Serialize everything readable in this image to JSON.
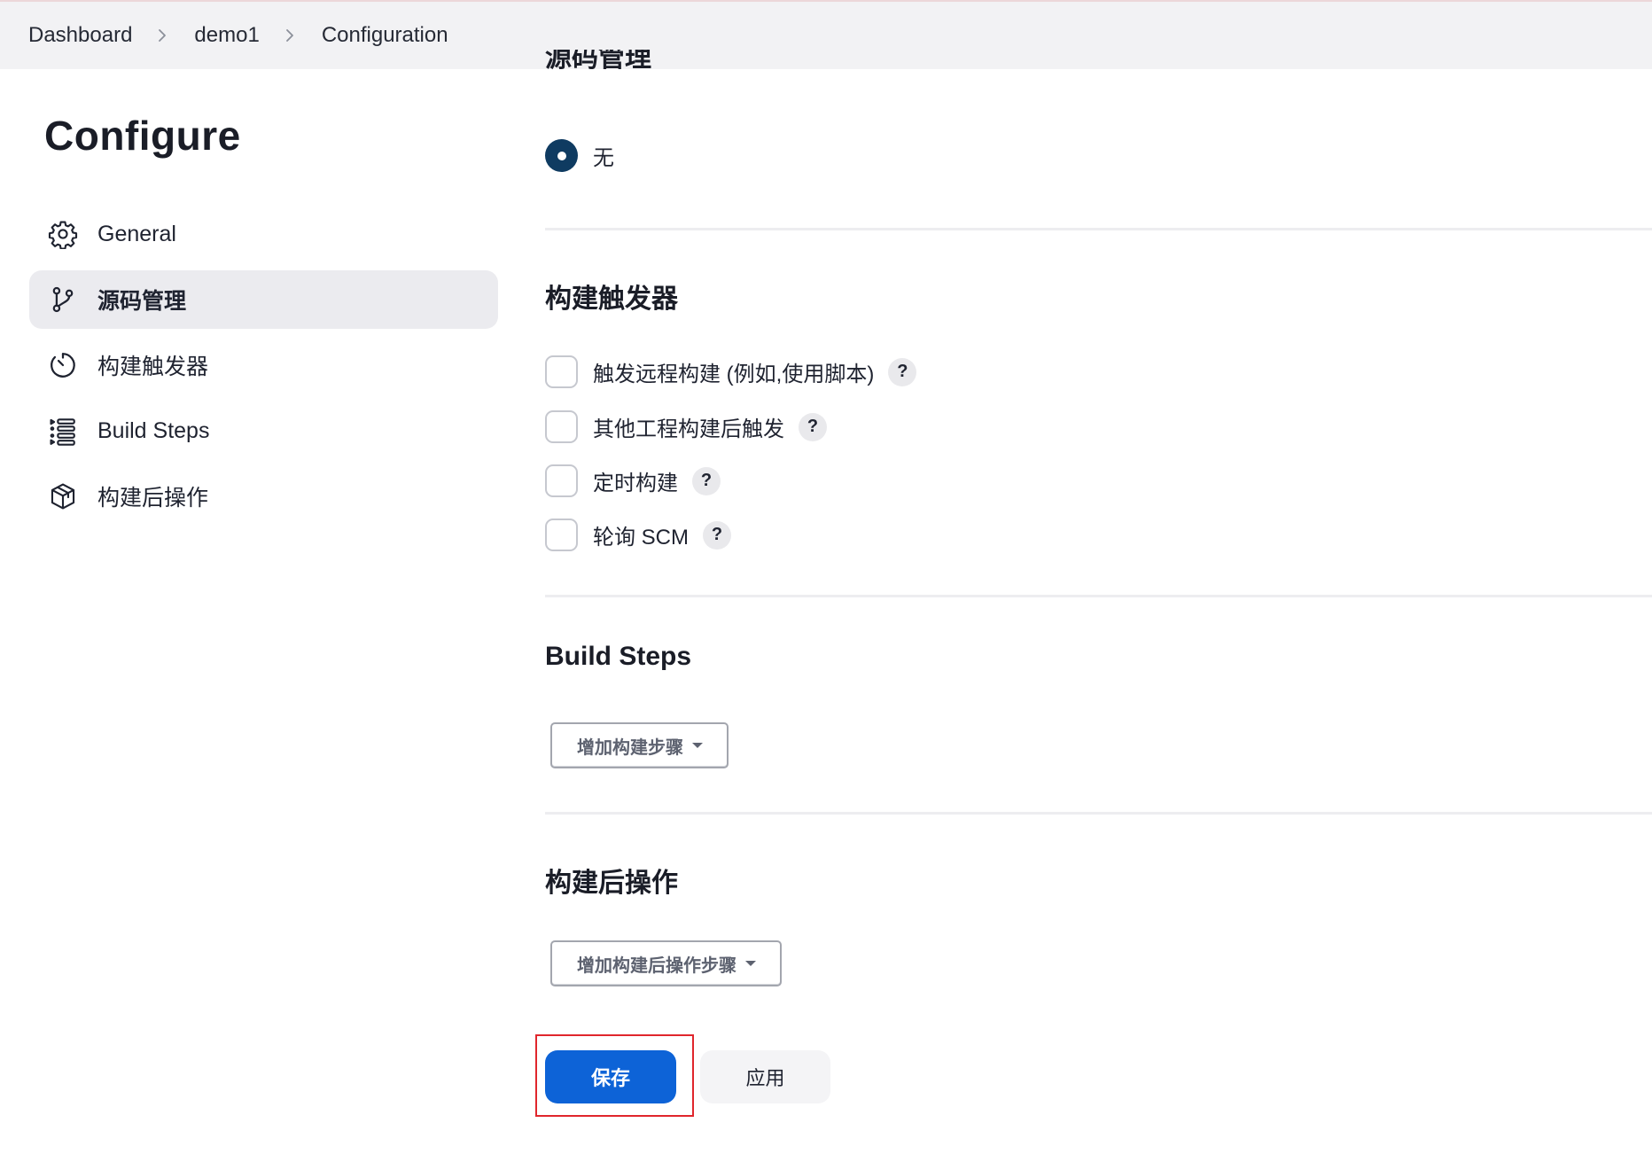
{
  "breadcrumb": {
    "items": [
      "Dashboard",
      "demo1",
      "Configuration"
    ]
  },
  "page": {
    "title": "Configure"
  },
  "sidebar": {
    "items": [
      {
        "label": "General",
        "icon": "gear-icon",
        "active": false
      },
      {
        "label": "源码管理",
        "icon": "git-branch-icon",
        "active": true
      },
      {
        "label": "构建触发器",
        "icon": "timer-icon",
        "active": false
      },
      {
        "label": "Build Steps",
        "icon": "list-steps-icon",
        "active": false
      },
      {
        "label": "构建后操作",
        "icon": "package-icon",
        "active": false
      }
    ]
  },
  "scm": {
    "heading": "源码管理",
    "option_label": "无",
    "selected": true
  },
  "triggers": {
    "heading": "构建触发器",
    "options": [
      {
        "label": "触发远程构建 (例如,使用脚本)",
        "checked": false,
        "help": "?"
      },
      {
        "label": "其他工程构建后触发",
        "checked": false,
        "help": "?"
      },
      {
        "label": "定时构建",
        "checked": false,
        "help": "?"
      },
      {
        "label": "轮询 SCM",
        "checked": false,
        "help": "?"
      }
    ]
  },
  "build_steps": {
    "heading": "Build Steps",
    "add_button": "增加构建步骤"
  },
  "post_build": {
    "heading": "构建后操作",
    "add_button": "增加构建后操作步骤"
  },
  "actions": {
    "save_label": "保存",
    "apply_label": "应用"
  },
  "colors": {
    "primary": "#0d63d7",
    "radio_selected": "#0f3b61",
    "highlight_border": "#e0262c"
  }
}
